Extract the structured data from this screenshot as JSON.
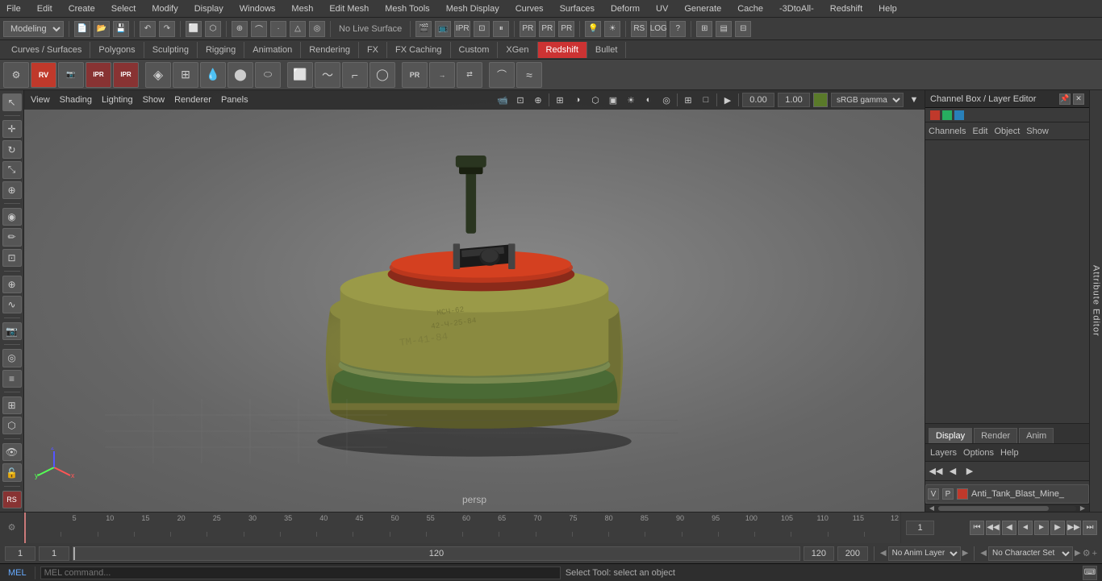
{
  "menubar": {
    "items": [
      "File",
      "Edit",
      "Create",
      "Select",
      "Modify",
      "Display",
      "Windows",
      "Mesh",
      "Edit Mesh",
      "Mesh Tools",
      "Mesh Display",
      "Curves",
      "Surfaces",
      "Deform",
      "UV",
      "Generate",
      "Cache",
      "-3DtoAll-",
      "Redshift",
      "Help"
    ]
  },
  "toolbar1": {
    "mode_dropdown": "Modeling",
    "live_surface_text": "No Live Surface"
  },
  "shelf_tabs": {
    "items": [
      "Curves / Surfaces",
      "Polygons",
      "Sculpting",
      "Rigging",
      "Animation",
      "Rendering",
      "FX",
      "FX Caching",
      "Custom",
      "XGen",
      "Redshift",
      "Bullet"
    ],
    "active": "Redshift"
  },
  "viewport": {
    "menu_items": [
      "View",
      "Shading",
      "Lighting",
      "Show",
      "Renderer",
      "Panels"
    ],
    "camera_label": "persp",
    "gamma_dropdown": "sRGB gamma",
    "coord_x": "0.00",
    "coord_y": "1.00"
  },
  "right_panel": {
    "title": "Channel Box / Layer Editor",
    "tabs": [
      "Display",
      "Render",
      "Anim"
    ],
    "active_tab": "Display",
    "subtabs": [
      "Channels",
      "Edit",
      "Object",
      "Show"
    ],
    "layers_label": "Layers",
    "layer_icons": [
      "◀◀",
      "◀",
      "▶"
    ],
    "layer_name": "Anti_Tank_Blast_Mine_"
  },
  "timeline": {
    "frame_numbers": [
      "",
      "5",
      "10",
      "15",
      "20",
      "25",
      "30",
      "35",
      "40",
      "45",
      "50",
      "55",
      "60",
      "65",
      "70",
      "75",
      "80",
      "85",
      "90",
      "95",
      "100",
      "105",
      "110",
      "115",
      "12"
    ],
    "current_frame": "1",
    "end_frame": "120",
    "end_time": "120",
    "total_time": "200"
  },
  "bottom_bar": {
    "current_frame_left": "1",
    "current_frame_mid": "1",
    "anim_layer_label": "No Anim Layer",
    "char_set_label": "No Character Set",
    "mel_label": "MEL",
    "status_text": "Select Tool: select an object",
    "range_start": "1",
    "range_end": "120",
    "playback_controls": [
      "⏮",
      "⏭",
      "◀",
      "▶",
      "◀◀",
      "▶▶",
      "⏮",
      "⏭"
    ]
  },
  "icons": {
    "gear": "⚙",
    "arrow": "↗",
    "select": "↖",
    "rotate": "↻",
    "scale": "⤡",
    "snap": "⊕",
    "eye": "👁",
    "camera": "📷",
    "grid": "⊞",
    "move": "✛",
    "lasso": "⬡",
    "brush": "✏",
    "magnet": "⊗",
    "layers": "≡",
    "lock": "🔒",
    "v_btn": "V",
    "p_btn": "P"
  },
  "colors": {
    "bg_dark": "#2e2e2e",
    "bg_mid": "#3a3a3a",
    "bg_light": "#444444",
    "accent_blue": "#5588bb",
    "redshift_tab": "#cc3333",
    "layer_color": "#c0392b",
    "text_light": "#cccccc",
    "text_dim": "#999999"
  }
}
